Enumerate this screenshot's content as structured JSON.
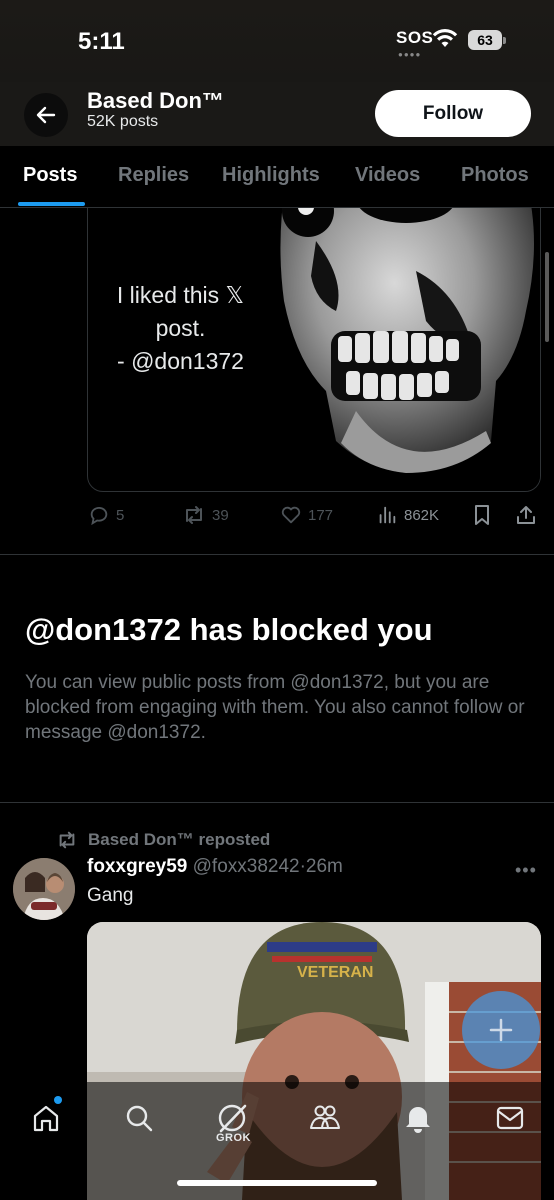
{
  "status_bar": {
    "time": "5:11",
    "carrier": "SOS",
    "battery": "63"
  },
  "header": {
    "name": "Based Don™",
    "post_count": "52K posts",
    "follow_label": "Follow"
  },
  "tabs": [
    {
      "label": "Posts",
      "active": true
    },
    {
      "label": "Replies"
    },
    {
      "label": "Highlights"
    },
    {
      "label": "Videos"
    },
    {
      "label": "Photos"
    }
  ],
  "quoted_image": {
    "line1": "I liked this 𝕏",
    "line2": "post.",
    "line3": "- @don1372"
  },
  "post_actions": {
    "replies": "5",
    "reposts": "39",
    "likes": "177",
    "views": "862K"
  },
  "blocked_notice": {
    "title": "@don1372 has blocked you",
    "body": "You can view public posts from @don1372, but you are blocked from engaging with them. You also cannot follow or message @don1372."
  },
  "repost": {
    "repost_label": "Based Don™ reposted",
    "author_name": "foxxgrey59",
    "author_handle": "@foxx38242",
    "time": "26m",
    "text": "Gang"
  },
  "bottom_nav": {
    "grok_label": "GROK",
    "items": [
      "home-icon",
      "search-icon",
      "grok-icon",
      "communities-icon",
      "notifications-icon",
      "messages-icon"
    ]
  },
  "colors": {
    "accent": "#1d9bf0",
    "background": "#000000",
    "muted_text": "#71767b",
    "divider": "#2f3336"
  }
}
